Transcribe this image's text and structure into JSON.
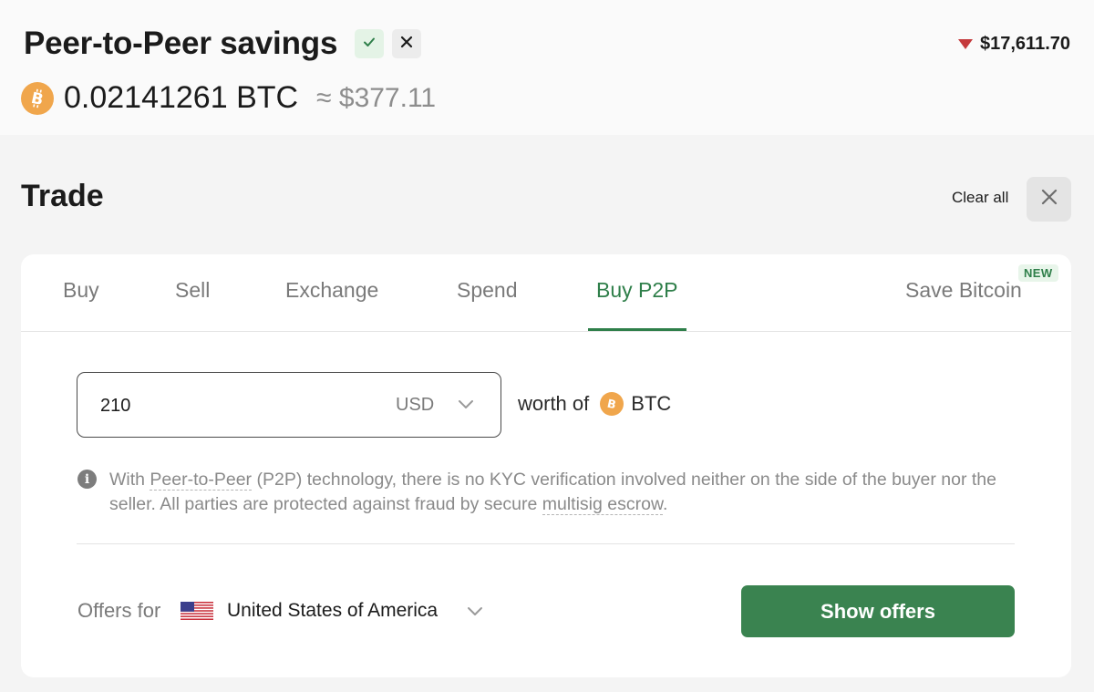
{
  "wallet": {
    "title": "Peer-to-Peer savings",
    "btc_price": "$17,611.70",
    "balance_btc": "0.02141261 BTC",
    "balance_usd": "≈ $377.11",
    "coin_icon": "bitcoin-icon",
    "price_trend_icon": "down-triangle-icon"
  },
  "trade": {
    "title": "Trade",
    "clear_all": "Clear all",
    "close_icon": "close-icon"
  },
  "tabs": [
    {
      "label": "Buy",
      "active": false
    },
    {
      "label": "Sell",
      "active": false
    },
    {
      "label": "Exchange",
      "active": false
    },
    {
      "label": "Spend",
      "active": false
    },
    {
      "label": "Buy P2P",
      "active": true
    },
    {
      "label": "Save Bitcoin",
      "active": false,
      "badge": "NEW"
    }
  ],
  "amount": {
    "value": "210",
    "currency": "USD",
    "worth_of": "worth of",
    "asset": "BTC"
  },
  "info": {
    "part1": "With ",
    "link1": "Peer-to-Peer",
    "part2": " (P2P) technology, there is no KYC verification involved neither on the side of the buyer nor the seller. All parties are protected against fraud by secure ",
    "link2": "multisig escrow",
    "part3": "."
  },
  "offers": {
    "label": "Offers for",
    "country": "United States of America",
    "flag_icon": "us-flag-icon",
    "button": "Show offers"
  },
  "colors": {
    "accent_green": "#2f7f4a",
    "button_green": "#3a8350",
    "bitcoin_orange": "#f0a64c",
    "price_down_red": "#c4393b"
  }
}
